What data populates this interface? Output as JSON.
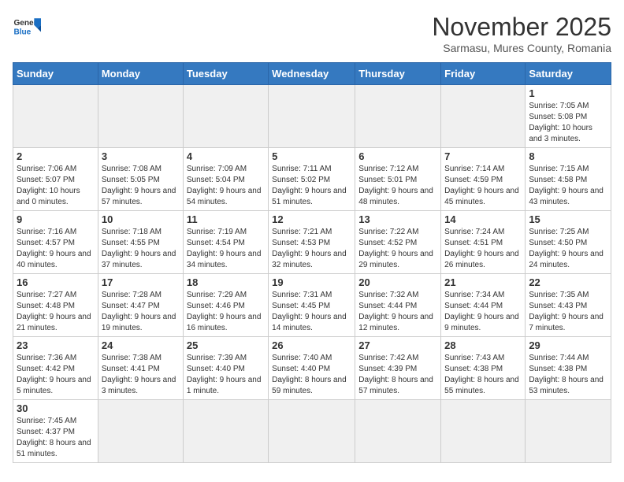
{
  "header": {
    "logo": {
      "line1": "General",
      "line2": "Blue"
    },
    "title": "November 2025",
    "subtitle": "Sarmasu, Mures County, Romania"
  },
  "calendar": {
    "headers": [
      "Sunday",
      "Monday",
      "Tuesday",
      "Wednesday",
      "Thursday",
      "Friday",
      "Saturday"
    ],
    "weeks": [
      [
        {
          "day": "",
          "info": ""
        },
        {
          "day": "",
          "info": ""
        },
        {
          "day": "",
          "info": ""
        },
        {
          "day": "",
          "info": ""
        },
        {
          "day": "",
          "info": ""
        },
        {
          "day": "",
          "info": ""
        },
        {
          "day": "1",
          "info": "Sunrise: 7:05 AM\nSunset: 5:08 PM\nDaylight: 10 hours\nand 3 minutes."
        }
      ],
      [
        {
          "day": "2",
          "info": "Sunrise: 7:06 AM\nSunset: 5:07 PM\nDaylight: 10 hours\nand 0 minutes."
        },
        {
          "day": "3",
          "info": "Sunrise: 7:08 AM\nSunset: 5:05 PM\nDaylight: 9 hours\nand 57 minutes."
        },
        {
          "day": "4",
          "info": "Sunrise: 7:09 AM\nSunset: 5:04 PM\nDaylight: 9 hours\nand 54 minutes."
        },
        {
          "day": "5",
          "info": "Sunrise: 7:11 AM\nSunset: 5:02 PM\nDaylight: 9 hours\nand 51 minutes."
        },
        {
          "day": "6",
          "info": "Sunrise: 7:12 AM\nSunset: 5:01 PM\nDaylight: 9 hours\nand 48 minutes."
        },
        {
          "day": "7",
          "info": "Sunrise: 7:14 AM\nSunset: 4:59 PM\nDaylight: 9 hours\nand 45 minutes."
        },
        {
          "day": "8",
          "info": "Sunrise: 7:15 AM\nSunset: 4:58 PM\nDaylight: 9 hours\nand 43 minutes."
        }
      ],
      [
        {
          "day": "9",
          "info": "Sunrise: 7:16 AM\nSunset: 4:57 PM\nDaylight: 9 hours\nand 40 minutes."
        },
        {
          "day": "10",
          "info": "Sunrise: 7:18 AM\nSunset: 4:55 PM\nDaylight: 9 hours\nand 37 minutes."
        },
        {
          "day": "11",
          "info": "Sunrise: 7:19 AM\nSunset: 4:54 PM\nDaylight: 9 hours\nand 34 minutes."
        },
        {
          "day": "12",
          "info": "Sunrise: 7:21 AM\nSunset: 4:53 PM\nDaylight: 9 hours\nand 32 minutes."
        },
        {
          "day": "13",
          "info": "Sunrise: 7:22 AM\nSunset: 4:52 PM\nDaylight: 9 hours\nand 29 minutes."
        },
        {
          "day": "14",
          "info": "Sunrise: 7:24 AM\nSunset: 4:51 PM\nDaylight: 9 hours\nand 26 minutes."
        },
        {
          "day": "15",
          "info": "Sunrise: 7:25 AM\nSunset: 4:50 PM\nDaylight: 9 hours\nand 24 minutes."
        }
      ],
      [
        {
          "day": "16",
          "info": "Sunrise: 7:27 AM\nSunset: 4:48 PM\nDaylight: 9 hours\nand 21 minutes."
        },
        {
          "day": "17",
          "info": "Sunrise: 7:28 AM\nSunset: 4:47 PM\nDaylight: 9 hours\nand 19 minutes."
        },
        {
          "day": "18",
          "info": "Sunrise: 7:29 AM\nSunset: 4:46 PM\nDaylight: 9 hours\nand 16 minutes."
        },
        {
          "day": "19",
          "info": "Sunrise: 7:31 AM\nSunset: 4:45 PM\nDaylight: 9 hours\nand 14 minutes."
        },
        {
          "day": "20",
          "info": "Sunrise: 7:32 AM\nSunset: 4:44 PM\nDaylight: 9 hours\nand 12 minutes."
        },
        {
          "day": "21",
          "info": "Sunrise: 7:34 AM\nSunset: 4:44 PM\nDaylight: 9 hours\nand 9 minutes."
        },
        {
          "day": "22",
          "info": "Sunrise: 7:35 AM\nSunset: 4:43 PM\nDaylight: 9 hours\nand 7 minutes."
        }
      ],
      [
        {
          "day": "23",
          "info": "Sunrise: 7:36 AM\nSunset: 4:42 PM\nDaylight: 9 hours\nand 5 minutes."
        },
        {
          "day": "24",
          "info": "Sunrise: 7:38 AM\nSunset: 4:41 PM\nDaylight: 9 hours\nand 3 minutes."
        },
        {
          "day": "25",
          "info": "Sunrise: 7:39 AM\nSunset: 4:40 PM\nDaylight: 9 hours\nand 1 minute."
        },
        {
          "day": "26",
          "info": "Sunrise: 7:40 AM\nSunset: 4:40 PM\nDaylight: 8 hours\nand 59 minutes."
        },
        {
          "day": "27",
          "info": "Sunrise: 7:42 AM\nSunset: 4:39 PM\nDaylight: 8 hours\nand 57 minutes."
        },
        {
          "day": "28",
          "info": "Sunrise: 7:43 AM\nSunset: 4:38 PM\nDaylight: 8 hours\nand 55 minutes."
        },
        {
          "day": "29",
          "info": "Sunrise: 7:44 AM\nSunset: 4:38 PM\nDaylight: 8 hours\nand 53 minutes."
        }
      ],
      [
        {
          "day": "30",
          "info": "Sunrise: 7:45 AM\nSunset: 4:37 PM\nDaylight: 8 hours\nand 51 minutes."
        },
        {
          "day": "",
          "info": ""
        },
        {
          "day": "",
          "info": ""
        },
        {
          "day": "",
          "info": ""
        },
        {
          "day": "",
          "info": ""
        },
        {
          "day": "",
          "info": ""
        },
        {
          "day": "",
          "info": ""
        }
      ]
    ]
  }
}
